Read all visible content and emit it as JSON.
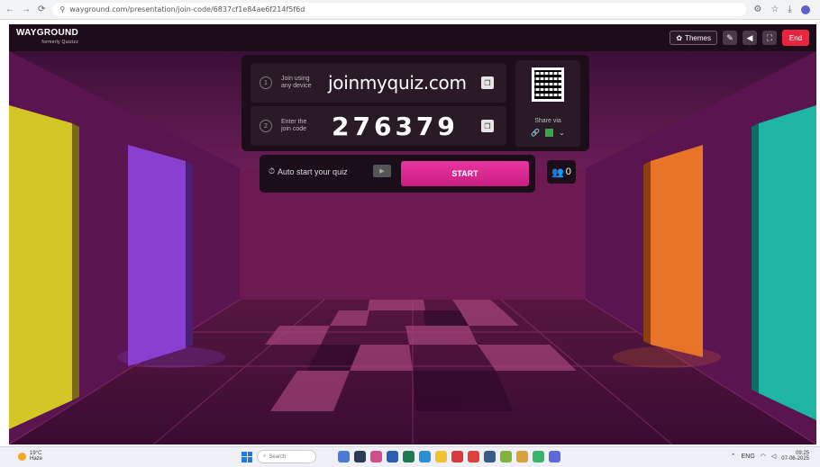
{
  "browser": {
    "url": "wayground.com/presentation/join-code/6837cf1e84ae6f214f5f6d",
    "back_icon": "arrow-left",
    "forward_icon": "arrow-right",
    "reload_icon": "reload",
    "site_info_icon": "tune"
  },
  "header": {
    "logo_text": "WAYGROUND",
    "logo_sub": "formerly Quizizz",
    "themes_label": "Themes",
    "end_label": "End",
    "accent": "#e8253f"
  },
  "join": {
    "step1_num": "1",
    "step1_label": "Join using any device",
    "url": "joinmyquiz.com",
    "step2_num": "2",
    "step2_label": "Enter the join code",
    "code": "276379",
    "share_label": "Share via"
  },
  "start": {
    "auto_start_label": "Auto start your quiz",
    "start_label": "START",
    "player_count": "0",
    "start_color": "#e8359d"
  },
  "taskbar": {
    "weather_temp": "19°C",
    "weather_desc": "Haze",
    "search_placeholder": "Search",
    "time": "09:25",
    "date": "07-06-2025",
    "language": "ENG"
  }
}
